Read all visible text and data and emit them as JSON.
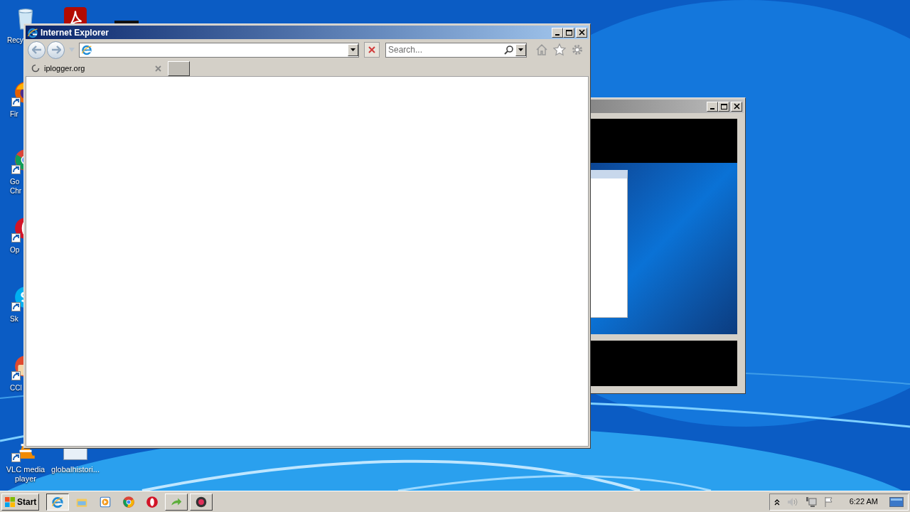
{
  "desktop_icons": [
    {
      "kind": "recycle-bin",
      "lines": [
        "Recy"
      ]
    },
    {
      "kind": "acrobat"
    },
    {
      "kind": "app"
    },
    {
      "kind": "firefox",
      "lines": [
        "Fir"
      ]
    },
    {
      "kind": "chrome",
      "lines": [
        "Go",
        "Chr"
      ]
    },
    {
      "kind": "opera",
      "lines": [
        "Op"
      ]
    },
    {
      "kind": "skype",
      "lines": [
        "Sk"
      ]
    },
    {
      "kind": "ccleaner",
      "lines": [
        "CCl"
      ]
    },
    {
      "kind": "vlc",
      "lines": [
        "VLC media",
        "player"
      ]
    },
    {
      "kind": "file",
      "lines": [
        "globalhistori..."
      ]
    }
  ],
  "browser": {
    "title": "Internet Explorer",
    "search_placeholder": "Search...",
    "tabs": [
      {
        "label": "iplogger.org",
        "loading": true,
        "selected": true
      }
    ]
  },
  "taskbar": {
    "start": "Start",
    "items": [
      {
        "kind": "ie",
        "running": true,
        "selected": true
      },
      {
        "kind": "explorer",
        "running": false,
        "selected": false
      },
      {
        "kind": "media",
        "running": false,
        "selected": false
      },
      {
        "kind": "chrome",
        "running": false,
        "selected": false
      },
      {
        "kind": "opera",
        "running": false,
        "selected": false
      },
      {
        "kind": "arrow",
        "running": true,
        "selected": false
      },
      {
        "kind": "record",
        "running": true,
        "selected": false
      }
    ],
    "clock": "6:22 AM"
  }
}
